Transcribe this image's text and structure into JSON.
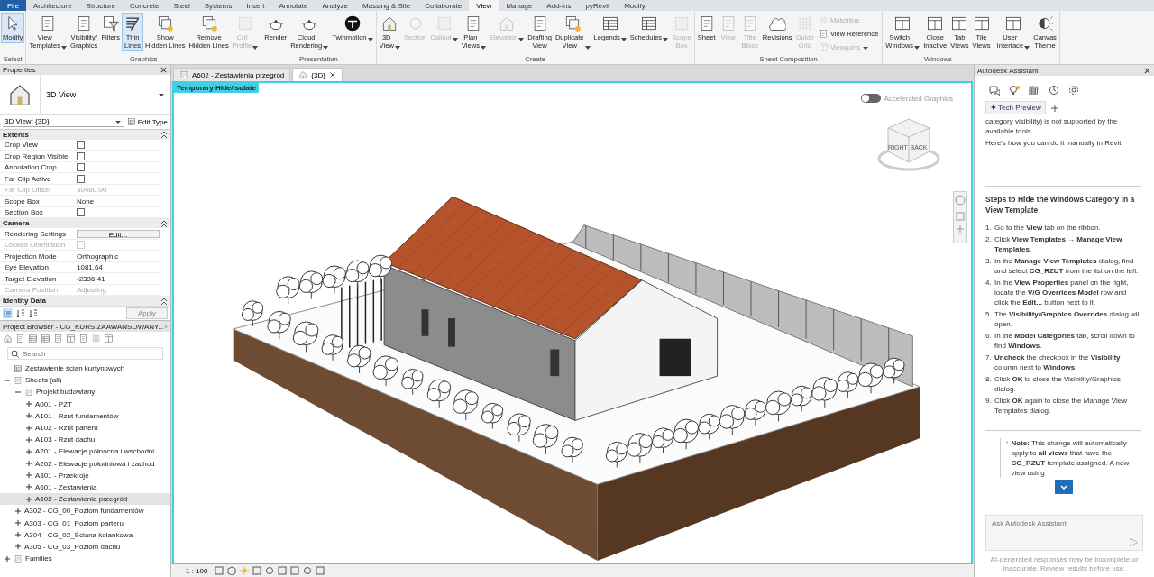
{
  "menu_tabs": [
    {
      "label": "File",
      "kind": "file",
      "selected": false
    },
    {
      "label": "Architecture",
      "kind": "tab",
      "selected": false
    },
    {
      "label": "Structure",
      "kind": "tab",
      "selected": false
    },
    {
      "label": "Concrete",
      "kind": "tab",
      "selected": false
    },
    {
      "label": "Steel",
      "kind": "tab",
      "selected": false
    },
    {
      "label": "Systems",
      "kind": "tab",
      "selected": false
    },
    {
      "label": "Insert",
      "kind": "tab",
      "selected": false
    },
    {
      "label": "Annotate",
      "kind": "tab",
      "selected": false
    },
    {
      "label": "Analyze",
      "kind": "tab",
      "selected": false
    },
    {
      "label": "Massing & Site",
      "kind": "tab",
      "selected": false
    },
    {
      "label": "Collaborate",
      "kind": "tab",
      "selected": false
    },
    {
      "label": "View",
      "kind": "tab",
      "selected": true
    },
    {
      "label": "Manage",
      "kind": "tab",
      "selected": false
    },
    {
      "label": "Add-ins",
      "kind": "tab",
      "selected": false
    },
    {
      "label": "pyRevit",
      "kind": "tab",
      "selected": false
    },
    {
      "label": "Modify",
      "kind": "tab",
      "selected": false
    }
  ],
  "ribbon": {
    "panels": [
      {
        "title": "Select",
        "items": [
          {
            "kind": "large",
            "label": "Modify",
            "selected": true,
            "disabled": false,
            "dropdown": false
          }
        ]
      },
      {
        "title": "Graphics",
        "items": [
          {
            "kind": "large",
            "label": "View\nTemplates",
            "selected": false,
            "disabled": false,
            "dropdown": true
          },
          {
            "kind": "large",
            "label": "Visibility/\nGraphics",
            "selected": false,
            "disabled": false,
            "dropdown": false
          },
          {
            "kind": "large",
            "label": "Filters",
            "selected": false,
            "disabled": false,
            "dropdown": false
          },
          {
            "kind": "large",
            "label": "Thin\nLines",
            "selected": true,
            "disabled": false,
            "dropdown": false
          },
          {
            "kind": "large",
            "label": "Show\nHidden Lines",
            "selected": false,
            "disabled": false,
            "dropdown": false
          },
          {
            "kind": "large",
            "label": "Remove\nHidden Lines",
            "selected": false,
            "disabled": false,
            "dropdown": false
          },
          {
            "kind": "large",
            "label": "Cut\nProfile",
            "selected": false,
            "disabled": true,
            "dropdown": true
          }
        ]
      },
      {
        "title": "Presentation",
        "items": [
          {
            "kind": "large",
            "label": "Render",
            "selected": false,
            "disabled": false,
            "dropdown": false
          },
          {
            "kind": "large",
            "label": "Cloud\nRendering",
            "selected": false,
            "disabled": false,
            "dropdown": true
          },
          {
            "kind": "large",
            "label": "Twinmotion",
            "selected": false,
            "disabled": false,
            "dropdown": true
          }
        ]
      },
      {
        "title": "Create",
        "items": [
          {
            "kind": "large",
            "label": "3D\nView",
            "selected": false,
            "disabled": false,
            "dropdown": true
          },
          {
            "kind": "large",
            "label": "Section",
            "selected": false,
            "disabled": true,
            "dropdown": false
          },
          {
            "kind": "large",
            "label": "Callout",
            "selected": false,
            "disabled": true,
            "dropdown": true
          },
          {
            "kind": "large",
            "label": "Plan\nViews",
            "selected": false,
            "disabled": false,
            "dropdown": true
          },
          {
            "kind": "large",
            "label": "Elevation",
            "selected": false,
            "disabled": true,
            "dropdown": true
          },
          {
            "kind": "large",
            "label": "Drafting\nView",
            "selected": false,
            "disabled": false,
            "dropdown": false
          },
          {
            "kind": "large",
            "label": "Duplicate\nView",
            "selected": false,
            "disabled": false,
            "dropdown": true
          },
          {
            "kind": "large",
            "label": "Legends",
            "selected": false,
            "disabled": false,
            "dropdown": true
          },
          {
            "kind": "large",
            "label": "Schedules",
            "selected": false,
            "disabled": false,
            "dropdown": true
          },
          {
            "kind": "large",
            "label": "Scope\nBox",
            "selected": false,
            "disabled": true,
            "dropdown": false
          }
        ]
      },
      {
        "title": "Sheet Composition",
        "items": [
          {
            "kind": "large",
            "label": "Sheet",
            "selected": false,
            "disabled": false,
            "dropdown": false
          },
          {
            "kind": "large",
            "label": "View",
            "selected": false,
            "disabled": true,
            "dropdown": false
          },
          {
            "kind": "large",
            "label": "Title\nBlock",
            "selected": false,
            "disabled": true,
            "dropdown": false
          },
          {
            "kind": "large",
            "label": "Revisions",
            "selected": false,
            "disabled": false,
            "dropdown": false
          },
          {
            "kind": "large",
            "label": "Guide\nGrid",
            "selected": false,
            "disabled": true,
            "dropdown": false
          },
          {
            "kind": "stack",
            "buttons": [
              {
                "label": "Matchline",
                "disabled": true,
                "dropdown": false
              },
              {
                "label": "View Reference",
                "disabled": false,
                "dropdown": false
              },
              {
                "label": "Viewports",
                "disabled": true,
                "dropdown": true
              }
            ]
          }
        ]
      },
      {
        "title": "Windows",
        "items": [
          {
            "kind": "large",
            "label": "Switch\nWindows",
            "selected": false,
            "disabled": false,
            "dropdown": true
          },
          {
            "kind": "large",
            "label": "Close\nInactive",
            "selected": false,
            "disabled": false,
            "dropdown": false
          },
          {
            "kind": "large",
            "label": "Tab\nViews",
            "selected": false,
            "disabled": false,
            "dropdown": false
          },
          {
            "kind": "large",
            "label": "Tile\nViews",
            "selected": false,
            "disabled": false,
            "dropdown": false
          }
        ]
      },
      {
        "items": [
          {
            "kind": "large",
            "label": "User\nInterface",
            "selected": false,
            "disabled": false,
            "dropdown": true
          },
          {
            "kind": "large",
            "label": "Canvas\nTheme",
            "selected": false,
            "disabled": false,
            "dropdown": false
          }
        ]
      }
    ]
  },
  "properties": {
    "title": "Properties",
    "type_name": "3D View",
    "view_selector": "3D View: {3D}",
    "edit_type": "Edit Type",
    "groups": [
      {
        "title": "Extents",
        "rows": [
          {
            "name": "Crop View",
            "kind": "checkbox",
            "checked": false,
            "disabled": false
          },
          {
            "name": "Crop Region Visible",
            "kind": "checkbox",
            "checked": false,
            "disabled": false
          },
          {
            "name": "Annotation Crop",
            "kind": "checkbox",
            "checked": false,
            "disabled": false
          },
          {
            "name": "Far Clip Active",
            "kind": "checkbox",
            "checked": false,
            "disabled": false
          },
          {
            "name": "Far Clip Offset",
            "kind": "text",
            "value": "30480.00",
            "disabled": true
          },
          {
            "name": "Scope Box",
            "kind": "text",
            "value": "None",
            "disabled": false
          },
          {
            "name": "Section Box",
            "kind": "checkbox",
            "checked": false,
            "disabled": false
          }
        ]
      },
      {
        "title": "Camera",
        "rows": [
          {
            "name": "Rendering Settings",
            "kind": "button",
            "value": "Edit...",
            "disabled": false
          },
          {
            "name": "Locked Orientation",
            "kind": "checkbox",
            "checked": false,
            "disabled": true
          },
          {
            "name": "Projection Mode",
            "kind": "text",
            "value": "Orthographic",
            "disabled": false
          },
          {
            "name": "Eye Elevation",
            "kind": "text",
            "value": "1081.64",
            "disabled": false
          },
          {
            "name": "Target Elevation",
            "kind": "text",
            "value": "-2336.41",
            "disabled": false
          },
          {
            "name": "Camera Position",
            "kind": "text",
            "value": "Adjusting",
            "disabled": true
          }
        ]
      },
      {
        "title": "Identity Data"
      }
    ],
    "apply": {
      "label": "Apply",
      "disabled": true
    }
  },
  "project_browser": {
    "title": "Project Browser - CG_KURS ZAAWANSOWANY...",
    "search": {
      "placeholder": "Search"
    },
    "tree": [
      {
        "label": "Zestawienie ścian kurtynowych",
        "kind": "schedule",
        "selected": false
      },
      {
        "label": "Sheets (all)",
        "kind": "folder",
        "expanded": true,
        "selected": false,
        "children": [
          {
            "label": "Projekt budowlany",
            "kind": "folder",
            "expanded": true,
            "selected": false,
            "children": [
              {
                "label": "A001 - PZT",
                "expanded": false,
                "selected": false
              },
              {
                "label": "A101 - Rzut fundamentów",
                "expanded": false,
                "selected": false
              },
              {
                "label": "A102 - Rzut parteru",
                "expanded": false,
                "selected": false
              },
              {
                "label": "A103 - Rzut dachu",
                "expanded": false,
                "selected": false
              },
              {
                "label": "A201 - Elewacje północna i wschodni",
                "expanded": false,
                "selected": false
              },
              {
                "label": "A202 - Elewacje południowa i zachod",
                "expanded": false,
                "selected": false
              },
              {
                "label": "A301 - Przekroje",
                "expanded": false,
                "selected": false
              },
              {
                "label": "A601 - Zestawienia",
                "expanded": false,
                "selected": false
              },
              {
                "label": "A602 - Zestawienia przegród",
                "expanded": false,
                "selected": true
              }
            ]
          },
          {
            "label": "A302 - CG_00_Poziom fundamentów",
            "expanded": false,
            "selected": false
          },
          {
            "label": "A303 - CG_01_Poziom parteru",
            "expanded": false,
            "selected": false
          },
          {
            "label": "A304 - CG_02_Ściana kolankowa",
            "expanded": false,
            "selected": false
          },
          {
            "label": "A305 - CG_03_Poziom dachu",
            "expanded": false,
            "selected": false
          }
        ]
      },
      {
        "label": "Families",
        "kind": "family",
        "expanded": false,
        "selected": false
      }
    ]
  },
  "view_tabs": [
    {
      "label": "A602 - Zestawienia przegród",
      "kind": "sheet",
      "selected": false
    },
    {
      "label": "{3D}",
      "kind": "model",
      "selected": true
    }
  ],
  "viewport": {
    "banner": "Temporary Hide/Isolate",
    "accelerated_graphics": {
      "label": "Accelerated Graphics",
      "on": false
    },
    "view_cube": {
      "labels": [
        "RIGHT",
        "BACK"
      ]
    },
    "scale": "1 : 100"
  },
  "assistant": {
    "title": "Autodesk Assistant",
    "tabs": [
      {
        "label": "Tech Preview",
        "selected": true
      }
    ],
    "intro": [
      "category visibility) is not supported by the available tools.",
      "Here's how you can do it manually in Revit:"
    ],
    "heading": "Steps to Hide the Windows Category in a View Template",
    "steps": [
      {
        "number": "1.",
        "text": "Go to the **View** tab on the ribbon."
      },
      {
        "number": "2.",
        "text": "Click **View Templates** → **Manage View Templates**."
      },
      {
        "number": "3.",
        "text": "In the **Manage View Templates** dialog, find and select **CG_RZUT** from the list on the left."
      },
      {
        "number": "4.",
        "text": "In the **View Properties** panel on the right, locate the **V/G Overrides Model** row and click the **Edit...** button next to it."
      },
      {
        "number": "5.",
        "text": "The **Visibility/Graphics Overrides** dialog will open."
      },
      {
        "number": "6.",
        "text": "In the **Model Categories** tab, scroll down to find **Windows**."
      },
      {
        "number": "7.",
        "text": "**Uncheck** the checkbox in the **Visibility** column next to **Windows**."
      },
      {
        "number": "8.",
        "text": "Click **OK** to close the Visibility/Graphics dialog."
      },
      {
        "number": "9.",
        "text": "Click **OK** again to close the Manage View Templates dialog."
      }
    ],
    "note": "**Note:** This change will automatically apply to **all views** that have the **CG_RZUT** template assigned. A new view using",
    "input": {
      "placeholder": "Ask Autodesk Assistant"
    },
    "disclaimer": "AI-generated responses may be incomplete or inaccurate. Review results before use."
  }
}
